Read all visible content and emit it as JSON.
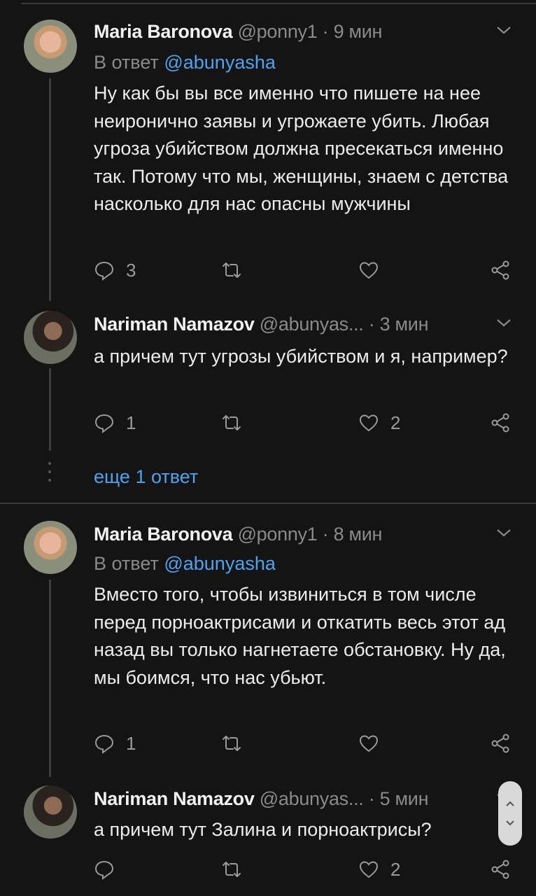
{
  "tweets": [
    {
      "author": "Maria Baronova",
      "handle": "@ponny1",
      "separator": "·",
      "time": "9 мин",
      "reply_prefix": "В ответ",
      "reply_mention": "@abunyasha",
      "text": "Ну как бы вы все именно что пишете на нее неиронично заявы и угрожаете убить. Любая угроза убийством должна пресекаться именно так. Потому что мы, женщины, знаем с детства насколько для нас опасны мужчины",
      "replies": "3",
      "retweets": "",
      "likes": "",
      "avatar_icon": "maria-avatar"
    },
    {
      "author": "Nariman Namazov",
      "handle": "@abunyas...",
      "separator": "·",
      "time": "3 мин",
      "text": "а причем тут угрозы убийством и я, например?",
      "replies": "1",
      "retweets": "",
      "likes": "2",
      "avatar_icon": "nariman-avatar"
    },
    {
      "author": "Maria Baronova",
      "handle": "@ponny1",
      "separator": "·",
      "time": "8 мин",
      "reply_prefix": "В ответ",
      "reply_mention": "@abunyasha",
      "text": "Вместо того, чтобы извиниться в том числе перед порноактрисами и откатить весь этот ад назад вы только нагнетаете обстановку. Ну да, мы боимся, что нас убьют.",
      "replies": "1",
      "retweets": "",
      "likes": "",
      "avatar_icon": "maria-avatar"
    },
    {
      "author": "Nariman Namazov",
      "handle": "@abunyas...",
      "separator": "·",
      "time": "5 мин",
      "text": "а причем тут Залина и порноактрисы?",
      "replies": "",
      "retweets": "",
      "likes": "2",
      "avatar_icon": "nariman-avatar"
    }
  ],
  "more_replies_label": "еще 1 ответ",
  "colors": {
    "background": "#141414",
    "accent": "#4da3ee",
    "muted": "#8a8a8a"
  }
}
